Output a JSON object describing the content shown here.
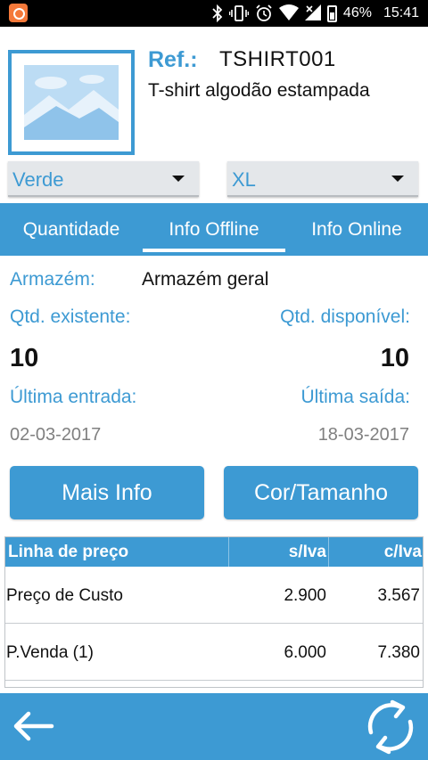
{
  "status_bar": {
    "battery_percent": "46%",
    "time": "15:41",
    "icons": [
      "app-notification-icon",
      "bluetooth-icon",
      "vibrate-icon",
      "alarm-icon",
      "wifi-icon",
      "signal-icon",
      "battery-icon"
    ]
  },
  "product": {
    "ref_label": "Ref.:",
    "ref_value": "TSHIRT001",
    "name": "T-shirt algodão estampada",
    "image_icon": "image-placeholder-icon"
  },
  "selectors": {
    "color": "Verde",
    "size": "XL"
  },
  "tabs": [
    {
      "label": "Quantidade"
    },
    {
      "label": "Info Offline"
    },
    {
      "label": "Info Online"
    }
  ],
  "active_tab": "Info Offline",
  "info": {
    "warehouse_label": "Armazém:",
    "warehouse_value": "Armazém geral",
    "qty_existing_label": "Qtd. existente:",
    "qty_available_label": "Qtd. disponível:",
    "qty_existing": "10",
    "qty_available": "10",
    "last_entry_label": "Última entrada:",
    "last_exit_label": "Última saída:",
    "last_entry_date": "02-03-2017",
    "last_exit_date": "18-03-2017"
  },
  "buttons": {
    "more_info": "Mais Info",
    "color_size": "Cor/Tamanho"
  },
  "price_table": {
    "headers": [
      "Linha de preço",
      "s/Iva",
      "c/Iva"
    ],
    "rows": [
      [
        "Preço de Custo",
        "2.900",
        "3.567"
      ],
      [
        "P.Venda (1)",
        "6.000",
        "7.380"
      ]
    ]
  },
  "bottom_bar": {
    "back_icon": "back-arrow-icon",
    "refresh_icon": "refresh-icon"
  },
  "colors": {
    "accent": "#3d9ad3",
    "status_bar": "#000000",
    "muted_text": "#808080"
  }
}
